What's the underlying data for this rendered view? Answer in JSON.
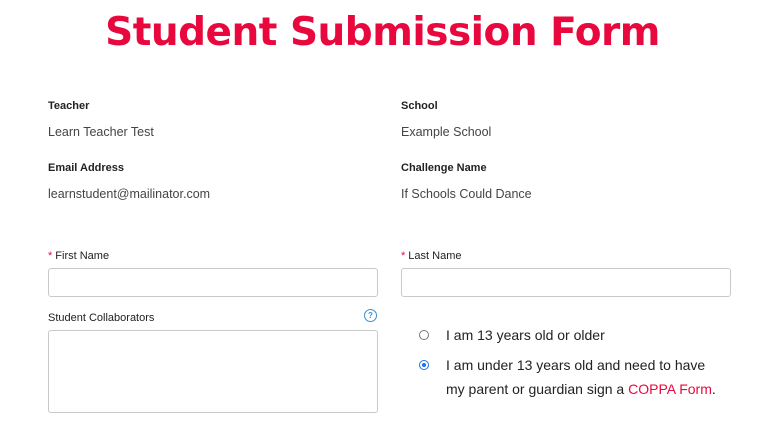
{
  "header": {
    "title": "Student Submission Form"
  },
  "info": {
    "teacher": {
      "label": "Teacher",
      "value": "Learn Teacher Test"
    },
    "school": {
      "label": "School",
      "value": "Example School"
    },
    "email": {
      "label": "Email Address",
      "value": "learnstudent@mailinator.com"
    },
    "challenge": {
      "label": "Challenge Name",
      "value": "If Schools Could Dance"
    }
  },
  "form": {
    "required_marker": "*",
    "first_name": {
      "label": "First Name",
      "value": ""
    },
    "last_name": {
      "label": "Last Name",
      "value": ""
    },
    "collaborators": {
      "label": "Student Collaborators",
      "help_icon": "question-mark",
      "value": ""
    },
    "age": {
      "options": [
        {
          "text": "I am 13 years old or older",
          "selected": false
        },
        {
          "text_line1": "I am under 13 years old and need to have",
          "text_line2_prefix": "my parent or guardian sign a ",
          "link": "COPPA Form",
          "text_suffix": ".",
          "selected": true
        }
      ]
    }
  },
  "colors": {
    "accent": "#e8083e",
    "radio_selected": "#1a73e8",
    "help_icon": "#3a8fd0"
  }
}
